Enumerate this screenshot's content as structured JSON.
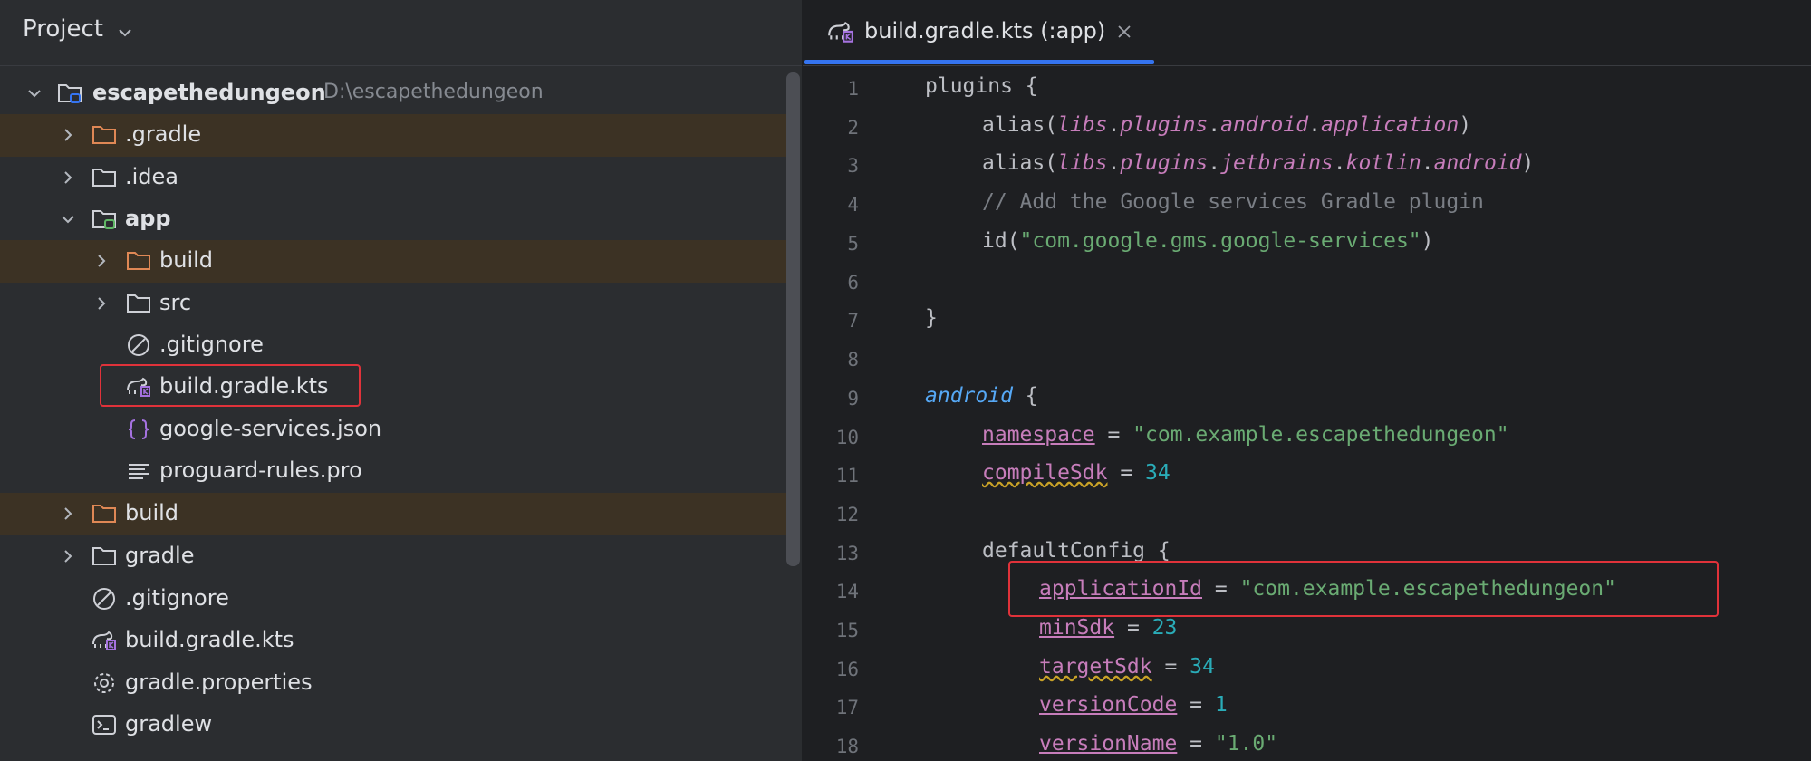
{
  "project": {
    "title": "Project",
    "root": {
      "name": "escapethedungeon",
      "path": "D:\\escapethedungeon"
    },
    "items": [
      {
        "label": ".gradle"
      },
      {
        "label": ".idea"
      },
      {
        "label": "app"
      },
      {
        "label": "build"
      },
      {
        "label": "src"
      },
      {
        "label": ".gitignore"
      },
      {
        "label": "build.gradle.kts"
      },
      {
        "label": "google-services.json"
      },
      {
        "label": "proguard-rules.pro"
      },
      {
        "label": "build"
      },
      {
        "label": "gradle"
      },
      {
        "label": ".gitignore"
      },
      {
        "label": "build.gradle.kts"
      },
      {
        "label": "gradle.properties"
      },
      {
        "label": "gradlew"
      }
    ]
  },
  "editor": {
    "tab_label": "build.gradle.kts (:app)",
    "line_numbers": [
      "1",
      "2",
      "3",
      "4",
      "5",
      "6",
      "7",
      "8",
      "9",
      "10",
      "11",
      "12",
      "13",
      "14",
      "15",
      "16",
      "17",
      "18"
    ],
    "code": {
      "l1": "plugins {",
      "l2_a": "alias(",
      "l2_b": "libs",
      "l2_c": ".",
      "l2_d": "plugins",
      "l2_e": ".",
      "l2_f": "android",
      "l2_g": ".",
      "l2_h": "application",
      "l2_i": ")",
      "l3_a": "alias(",
      "l3_b": "libs",
      "l3_c": ".",
      "l3_d": "plugins",
      "l3_e": ".",
      "l3_f": "jetbrains",
      "l3_g": ".",
      "l3_h": "kotlin",
      "l3_i": ".",
      "l3_j": "android",
      "l3_k": ")",
      "l4": "// Add the Google services Gradle plugin",
      "l5_a": "id(",
      "l5_b": "\"com.google.gms.google-services\"",
      "l5_c": ")",
      "l7": "}",
      "l9_a": "android",
      "l9_b": " {",
      "l10_a": "namespace",
      "l10_b": " = ",
      "l10_c": "\"com.example.escapethedungeon\"",
      "l11_a": "compileSdk",
      "l11_b": " = ",
      "l11_c": "34",
      "l13": "defaultConfig {",
      "l14_a": "applicationId",
      "l14_b": " = ",
      "l14_c": "\"com.example.escapethedungeon\"",
      "l15_a": "minSdk",
      "l15_b": " = ",
      "l15_c": "23",
      "l16_a": "targetSdk",
      "l16_b": " = ",
      "l16_c": "34",
      "l17_a": "versionCode",
      "l17_b": " = ",
      "l17_c": "1",
      "l18_a": "versionName",
      "l18_b": " = ",
      "l18_c": "\"1.0\""
    }
  },
  "colors": {
    "panel_bg": "#2b2d30",
    "editor_bg": "#1e1f22",
    "excluded_row": "#3c3224",
    "highlight_box": "#e0323a",
    "tab_accent": "#3574f0",
    "string": "#6aab73",
    "number": "#2aacb8",
    "property": "#c77dbb"
  },
  "icons": [
    "chevron-down-icon",
    "chevron-right-icon",
    "folder-icon",
    "module-folder-icon",
    "gradle-kts-icon",
    "ignore-file-icon",
    "json-icon",
    "text-file-icon",
    "settings-gear-icon",
    "terminal-icon",
    "close-icon"
  ]
}
